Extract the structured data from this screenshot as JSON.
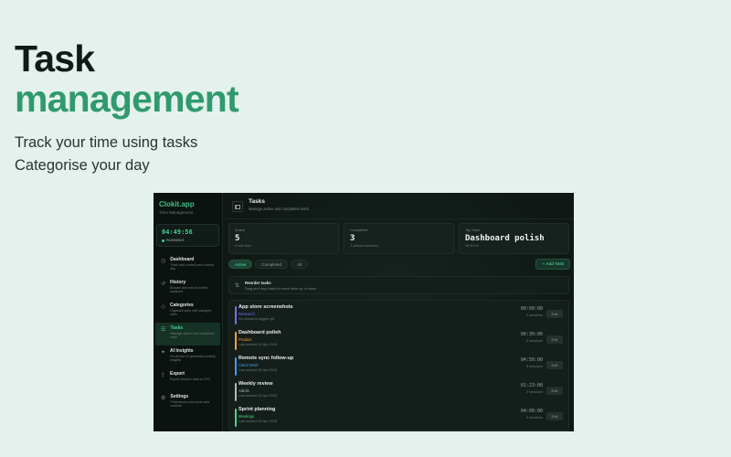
{
  "hero": {
    "line1": "Task",
    "line2": "management",
    "sub1": "Track your time using tasks",
    "sub2": "Categorise your day"
  },
  "colors": {
    "accent": "#2f9a6d",
    "background": "#e5f1ec",
    "app_bg": "#0f1815"
  },
  "app": {
    "brand": "Clokit.app",
    "tagline": "Time Management",
    "timer": {
      "time": "04:49:56",
      "state": "RUNNING"
    },
    "nav": [
      {
        "label": "Dashboard",
        "desc": "Track and control your current day",
        "icon": "clock-icon"
      },
      {
        "label": "History",
        "desc": "Browse and edit recorded sessions",
        "icon": "history-icon"
      },
      {
        "label": "Categories",
        "desc": "Organise work with category rules",
        "icon": "tag-icon"
      },
      {
        "label": "Tasks",
        "desc": "Manage active and completed work",
        "icon": "tasks-icon"
      },
      {
        "label": "AI Insights",
        "desc": "On-device AI generated activity insights",
        "icon": "sparkle-icon"
      },
      {
        "label": "Export",
        "desc": "Export session data to CSV",
        "icon": "export-icon"
      },
      {
        "label": "Settings",
        "desc": "Preferences and local data controls",
        "icon": "gear-icon"
      }
    ],
    "header": {
      "title": "Tasks",
      "subtitle": "Manage active and completed work"
    },
    "stats": [
      {
        "label": "Active",
        "value": "5",
        "note": "6 with time"
      },
      {
        "label": "Completed",
        "value": "3",
        "note": "2 without sessions"
      },
      {
        "label": "Top Task",
        "value": "Dashboard polish",
        "note": "08:30:00"
      }
    ],
    "filters": [
      "Active",
      "Completed",
      "All"
    ],
    "add_label": "+ Add Task",
    "reorder": {
      "title": "Reorder tasks",
      "subtitle": "Drag and drop tasks to move them up or down."
    },
    "edit_label": "Edit",
    "tasks": [
      {
        "name": "App store screenshots",
        "category": "Research",
        "color": "#7a6cf2",
        "last": "No sessions logged yet",
        "duration": "00:00:00",
        "sessions": "0 sessions"
      },
      {
        "name": "Dashboard polish",
        "category": "Product",
        "color": "#f0a03c",
        "last": "Last worked 30 Apr 2026",
        "duration": "00:30:00",
        "sessions": "5 sessions"
      },
      {
        "name": "Remote sync follow-up",
        "category": "Client Work",
        "color": "#3e9df0",
        "last": "Last worked 30 Apr 2026",
        "duration": "04:50:00",
        "sessions": "5 sessions"
      },
      {
        "name": "Weekly review",
        "category": "Admin",
        "color": "#b3bcb8",
        "last": "Last worked 28 Apr 2026",
        "duration": "01:23:00",
        "sessions": "2 sessions"
      },
      {
        "name": "Sprint planning",
        "category": "Meetings",
        "color": "#4fd27f",
        "last": "Last worked 30 Apr 2026",
        "duration": "04:00:00",
        "sessions": "4 sessions"
      }
    ]
  }
}
